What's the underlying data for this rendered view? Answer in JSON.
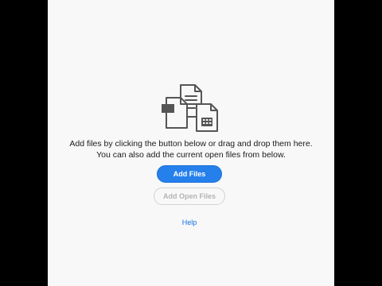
{
  "dropzone": {
    "illustration_icon": "files-stack-icon",
    "instruction_line1": "Add files by clicking the button below or drag and drop them here.",
    "instruction_line2": "You can also add the current open files from below."
  },
  "actions": {
    "add_files_label": "Add Files",
    "add_open_files_label": "Add Open Files",
    "add_open_files_enabled": false
  },
  "help": {
    "label": "Help"
  },
  "colors": {
    "accent": "#2680eb",
    "link": "#1473e6",
    "panel_bg": "#f8f8f8"
  }
}
